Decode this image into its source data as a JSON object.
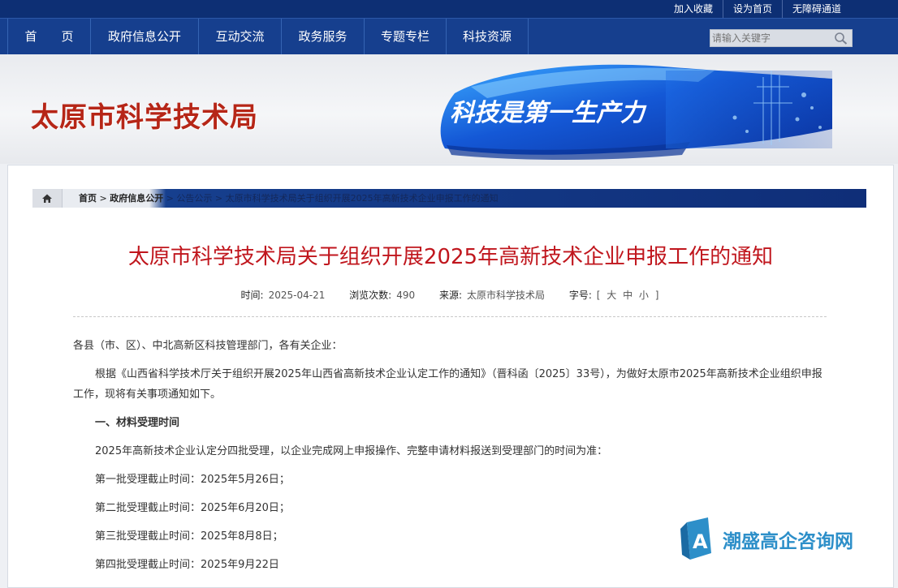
{
  "topbar": {
    "links": [
      "加入收藏",
      "设为首页",
      "无障碍通道"
    ]
  },
  "nav": {
    "items": [
      "首　　页",
      "政府信息公开",
      "互动交流",
      "政务服务",
      "专题专栏",
      "科技资源"
    ],
    "search_placeholder": "请输入关键字"
  },
  "banner": {
    "site_title": "太原市科学技术局",
    "slogan": "科技是第一生产力"
  },
  "breadcrumb": {
    "home": "首页",
    "sep": " > ",
    "level1": "政府信息公开",
    "level2": "公告公示",
    "current": "太原市科学技术局关于组织开展2025年高新技术企业申报工作的通知"
  },
  "article": {
    "title": "太原市科学技术局关于组织开展2025年高新技术企业申报工作的通知",
    "meta": {
      "time_label": "时间:",
      "time": "2025-04-21",
      "views_label": "浏览次数:",
      "views": "490",
      "source_label": "来源:",
      "source": "太原市科学技术局",
      "fontsize_label": "字号:",
      "fontsize_options": [
        "[",
        "大",
        "中",
        "小",
        "]"
      ]
    },
    "paragraphs": [
      "各县（市、区）、中北高新区科技管理部门，各有关企业：",
      "根据《山西省科学技术厅关于组织开展2025年山西省高新技术企业认定工作的通知》（晋科函〔2025〕33号），为做好太原市2025年高新技术企业组织申报工作，现将有关事项通知如下。",
      "一、材料受理时间",
      "2025年高新技术企业认定分四批受理，以企业完成网上申报操作、完整申请材料报送到受理部门的时间为准：",
      "第一批受理截止时间：2025年5月26日；",
      "第二批受理截止时间：2025年6月20日；",
      "第三批受理截止时间：2025年8月8日；",
      "第四批受理截止时间：2025年9月22日"
    ]
  },
  "watermark": {
    "text": "潮盛高企咨询网"
  },
  "colors": {
    "nav_blue": "#163f8e",
    "topbar_blue": "#0d2f74",
    "title_red": "#c0161d",
    "site_title_red": "#b62617"
  }
}
